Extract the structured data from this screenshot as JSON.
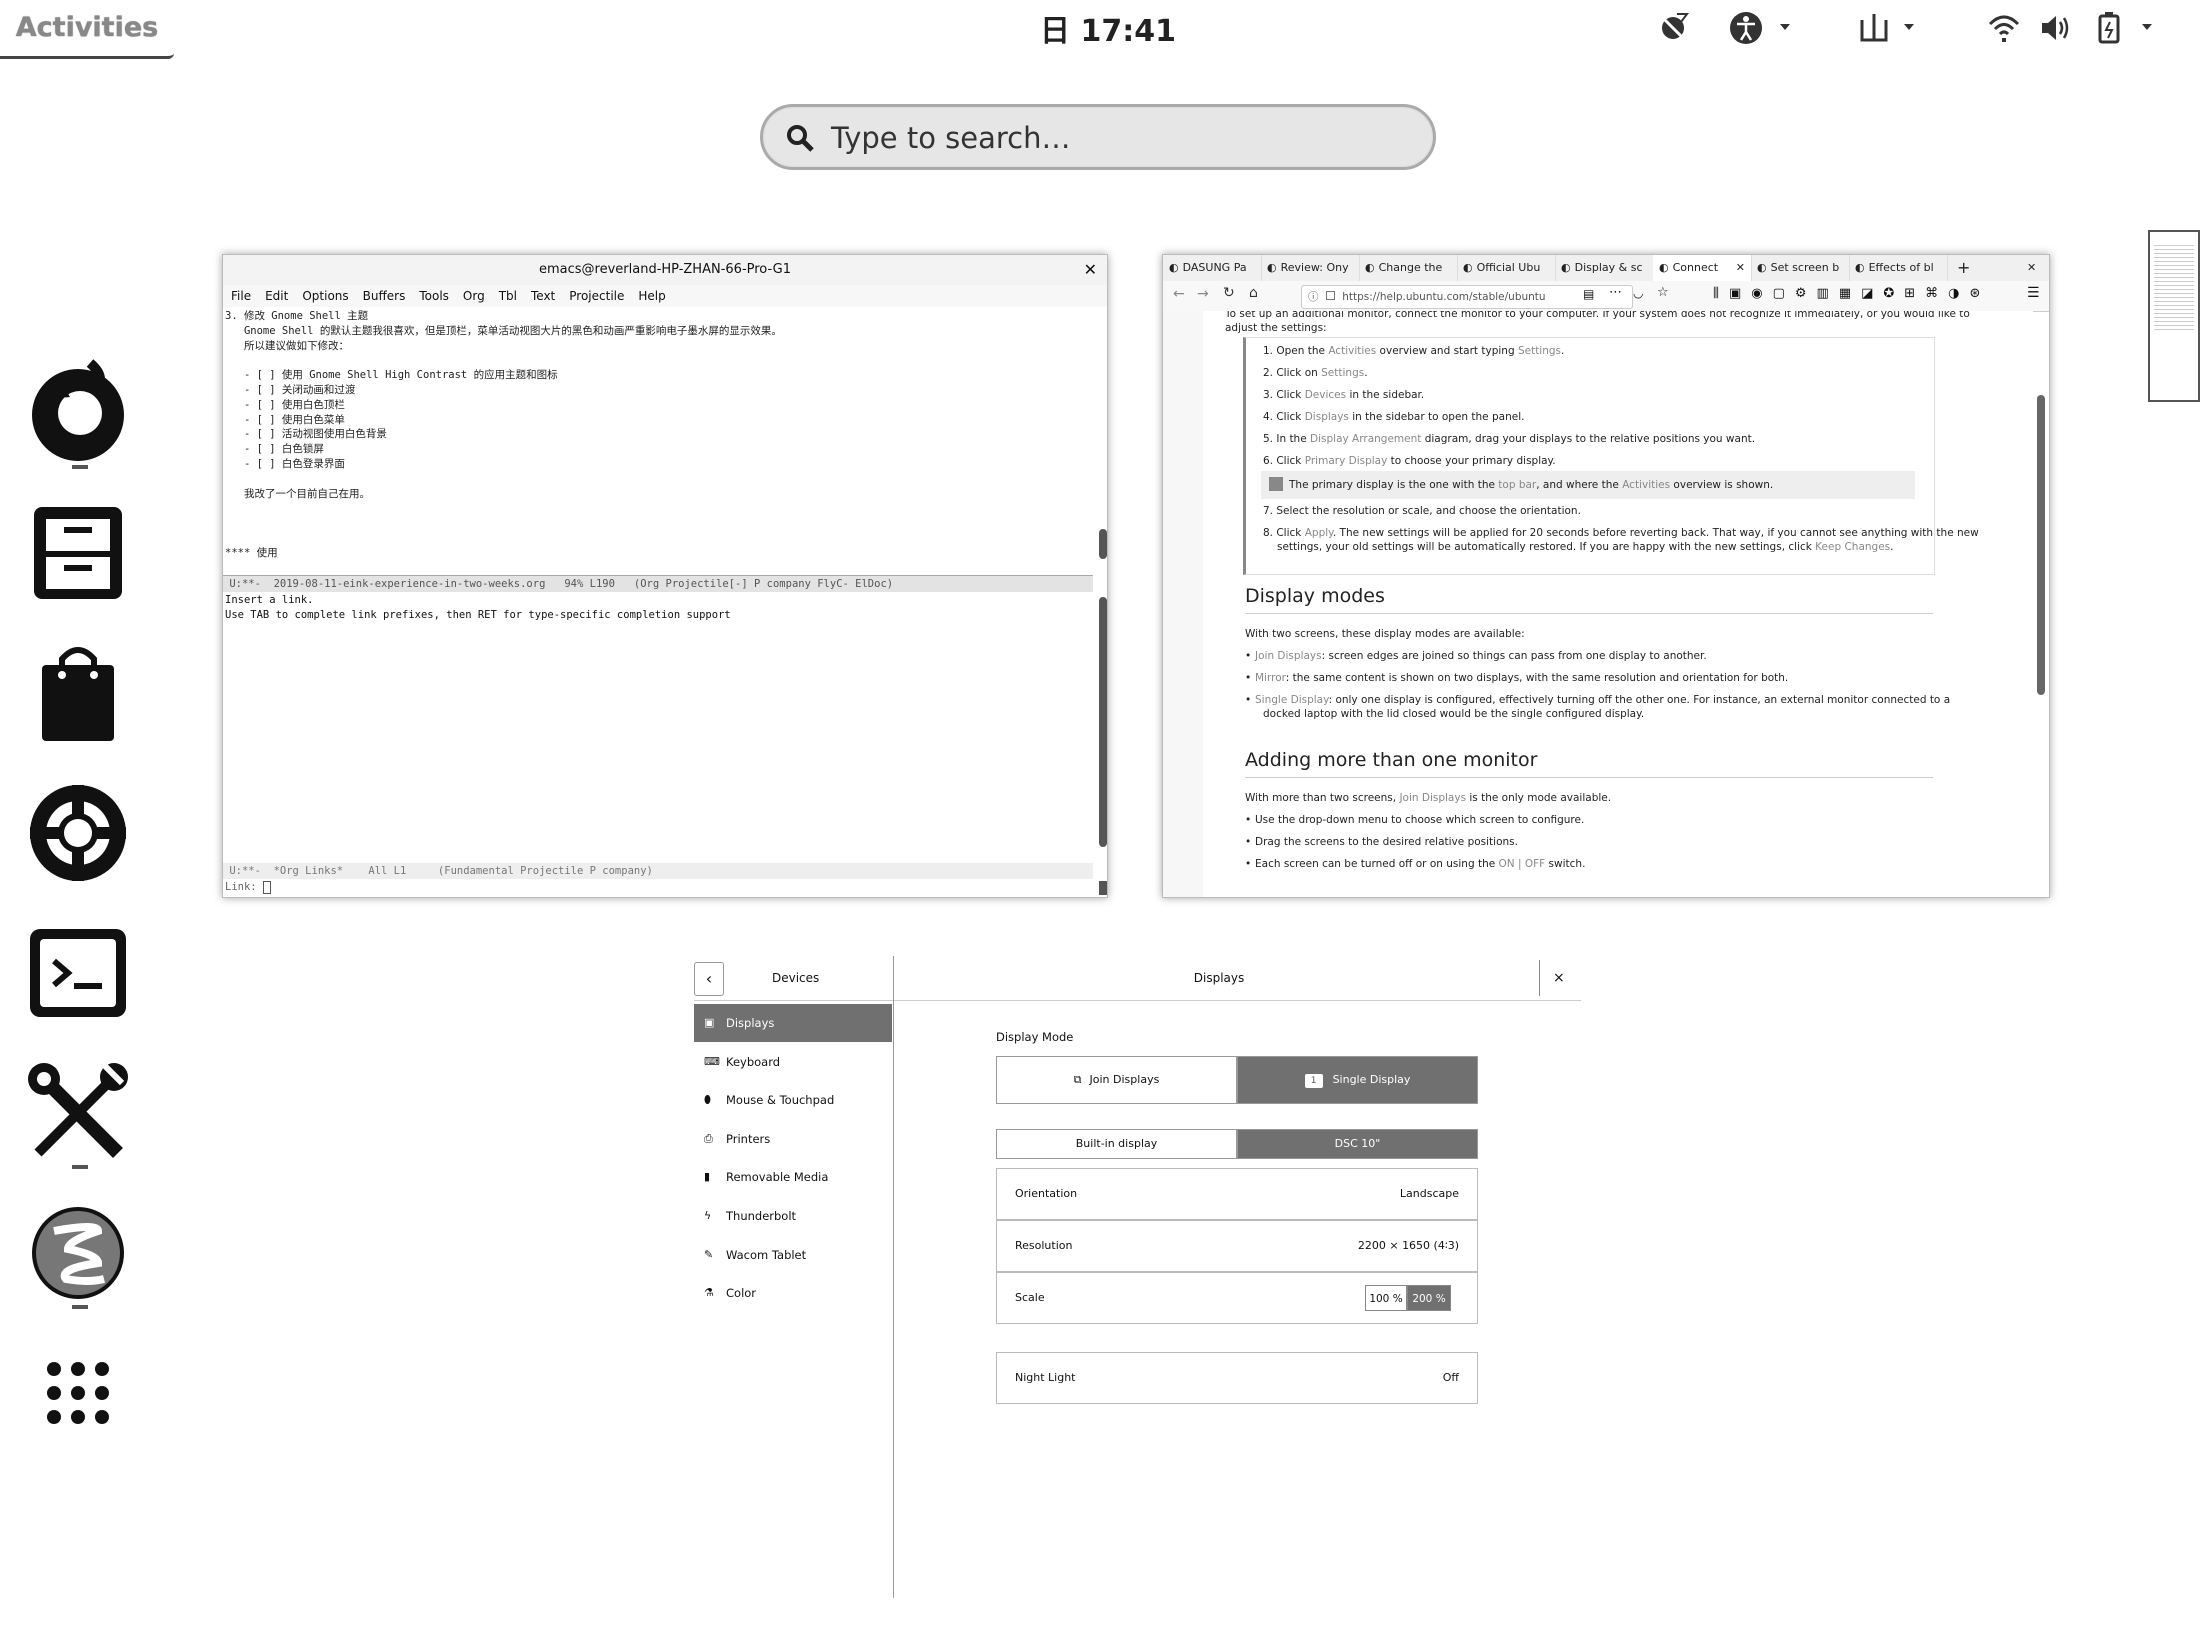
{
  "topbar": {
    "activities": "Activities",
    "clock_day": "日",
    "clock_time": "17:41"
  },
  "search": {
    "placeholder": "Type to search…"
  },
  "dash": {
    "items": [
      "firefox-icon",
      "files-cabinet-icon",
      "software-bag-icon",
      "help-lifebuoy-icon",
      "terminal-icon",
      "tools-icon",
      "emacs-icon",
      "show-apps-grid-icon"
    ]
  },
  "emacs": {
    "title": "emacs@reverland-HP-ZHAN-66-Pro-G1",
    "menu": [
      "File",
      "Edit",
      "Options",
      "Buffers",
      "Tools",
      "Org",
      "Tbl",
      "Text",
      "Projectile",
      "Help"
    ],
    "buffer_lines": [
      "3. 修改 Gnome Shell 主题",
      "   Gnome Shell 的默认主题我很喜欢，但是顶栏，菜单活动视图大片的黑色和动画严重影响电子墨水屏的显示效果。",
      "   所以建议做如下修改：",
      "",
      "   - [ ] 使用 Gnome Shell High Contrast 的应用主题和图标",
      "   - [ ] 关闭动画和过渡",
      "   - [ ] 使用白色顶栏",
      "   - [ ] 使用白色菜单",
      "   - [ ] 活动视图使用白色背景",
      "   - [ ] 白色锁屏",
      "   - [ ] 白色登录界面",
      "",
      "   我改了一个目前自己在用。",
      "",
      "",
      "",
      "**** 使用",
      ""
    ],
    "modeline1": " U:**-  2019-08-11-eink-experience-in-two-weeks.org   94% L190   (Org Projectile[-] P company FlyC- ElDoc)",
    "buffer2_lines": [
      "Insert a link.",
      "Use TAB to complete link prefixes, then RET for type-specific completion support"
    ],
    "modeline2": " U:**-  *Org Links*    All L1     (Fundamental Projectile P company)",
    "minibuffer": "Link: "
  },
  "firefox": {
    "tabs": [
      "DASUNG Pa",
      "Review: Ony",
      "Change the",
      "Official Ubu",
      "Display & sc",
      "Connect",
      "Set screen b",
      "Effects of bl"
    ],
    "url": "https://help.ubuntu.com/stable/ubuntu",
    "intro": "To set up an additional monitor, connect the monitor to your computer. If your system does not recognize it immediately, or you would like to",
    "intro2": "adjust the settings:",
    "steps": [
      {
        "pre": "1. Open the ",
        "link": "Activities",
        "post": " overview and start typing ",
        "link2": "Settings",
        "post2": "."
      },
      {
        "pre": "2. Click on ",
        "link": "Settings",
        "post": ".",
        "link2": "",
        "post2": ""
      },
      {
        "pre": "3. Click ",
        "link": "Devices",
        "post": " in the sidebar.",
        "link2": "",
        "post2": ""
      },
      {
        "pre": "4. Click ",
        "link": "Displays",
        "post": " in the sidebar to open the panel.",
        "link2": "",
        "post2": ""
      },
      {
        "pre": "5. In the ",
        "link": "Display Arrangement",
        "post": " diagram, drag your displays to the relative positions you want.",
        "link2": "",
        "post2": ""
      },
      {
        "pre": "6. Click ",
        "link": "Primary Display",
        "post": " to choose your primary display.",
        "link2": "",
        "post2": ""
      }
    ],
    "note": {
      "pre": "The primary display is the one with the ",
      "link": "top bar",
      "post": ", and where the ",
      "link2": "Activities",
      "post2": " overview is shown."
    },
    "step7": "7. Select the resolution or scale, and choose the orientation.",
    "step8_a": "8. Click ",
    "step8_link": "Apply",
    "step8_b": ". The new settings will be applied for 20 seconds before reverting back. That way, if you cannot see anything with the new",
    "step8_c": "settings, your old settings will be automatically restored. If you are happy with the new settings, click ",
    "step8_link2": "Keep Changes",
    "step8_d": ".",
    "h_modes": "Display modes",
    "modes_intro": "With two screens, these display modes are available:",
    "modes": [
      {
        "link": "Join Displays",
        "text": ": screen edges are joined so things can pass from one display to another."
      },
      {
        "link": "Mirror",
        "text": ": the same content is shown on two displays, with the same resolution and orientation for both."
      },
      {
        "link": "Single Display",
        "text": ": only one display is configured, effectively turning off the other one. For instance, an external monitor connected to a"
      }
    ],
    "modes_cont": "docked laptop with the lid closed would be the single configured display.",
    "h_more": "Adding more than one monitor",
    "more_intro_a": "With more than two screens, ",
    "more_intro_link": "Join Displays",
    "more_intro_b": " is the only mode available.",
    "more_items": [
      "Use the drop-down menu to choose which screen to configure.",
      "Drag the screens to the desired relative positions."
    ],
    "more_last_a": "Each screen can be turned off or on using the ",
    "more_last_link": "ON | OFF",
    "more_last_b": " switch."
  },
  "settings": {
    "back": "‹",
    "devices": "Devices",
    "title": "Displays",
    "close": "×",
    "sidebar": [
      {
        "icon": "displays-icon",
        "glyph": "▣",
        "label": "Displays",
        "active": true
      },
      {
        "icon": "keyboard-icon",
        "glyph": "⌨",
        "label": "Keyboard",
        "active": false
      },
      {
        "icon": "mouse-icon",
        "glyph": "⬮",
        "label": "Mouse & Touchpad",
        "active": false
      },
      {
        "icon": "printer-icon",
        "glyph": "⎙",
        "label": "Printers",
        "active": false
      },
      {
        "icon": "removable-media-icon",
        "glyph": "▮",
        "label": "Removable Media",
        "active": false
      },
      {
        "icon": "thunderbolt-icon",
        "glyph": "ϟ",
        "label": "Thunderbolt",
        "active": false
      },
      {
        "icon": "wacom-tablet-icon",
        "glyph": "✎",
        "label": "Wacom Tablet",
        "active": false
      },
      {
        "icon": "color-icon",
        "glyph": "⚗",
        "label": "Color",
        "active": false
      }
    ],
    "display_mode_label": "Display Mode",
    "join_displays": "Join Displays",
    "single_display": "Single Display",
    "single_badge": "1",
    "builtin": "Built-in display",
    "dsc": "DSC 10\"",
    "orientation_label": "Orientation",
    "orientation_value": "Landscape",
    "resolution_label": "Resolution",
    "resolution_value": "2200 × 1650 (4∶3)",
    "scale_label": "Scale",
    "scale_100": "100 %",
    "scale_200": "200 %",
    "nightlight_label": "Night Light",
    "nightlight_value": "Off"
  }
}
